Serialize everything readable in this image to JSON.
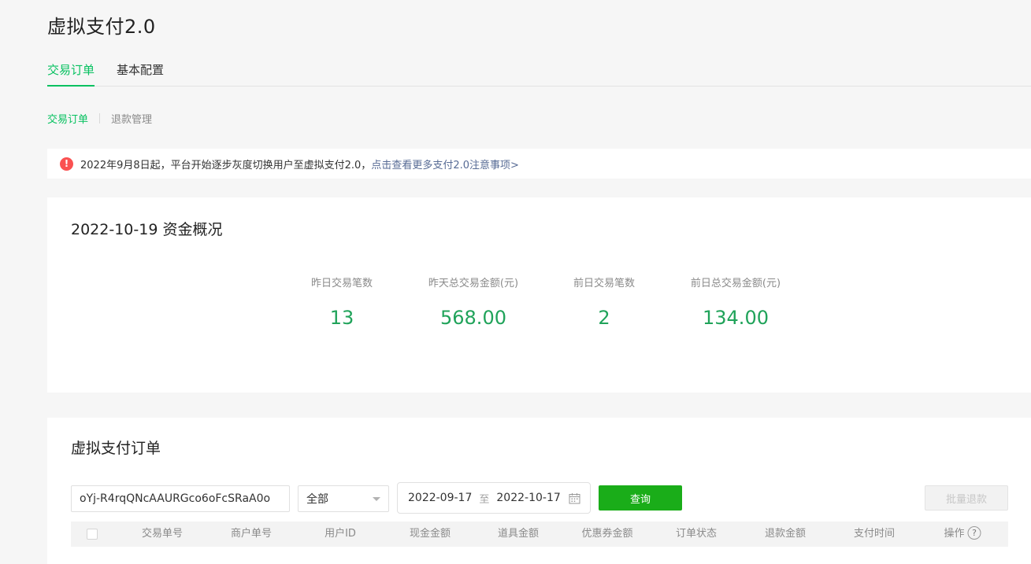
{
  "page": {
    "title": "虚拟支付2.0"
  },
  "main_tabs": [
    {
      "label": "交易订单",
      "active": true
    },
    {
      "label": "基本配置",
      "active": false
    }
  ],
  "sub_tabs": [
    {
      "label": "交易订单",
      "active": true
    },
    {
      "label": "退款管理",
      "active": false
    }
  ],
  "notice": {
    "icon": "exclamation-icon",
    "text": "2022年9月8日起，平台开始逐步灰度切换用户至虚拟支付2.0，",
    "link": "点击查看更多支付2.0注意事项>"
  },
  "summary": {
    "title": "2022-10-19 资金概况",
    "stats": [
      {
        "label": "昨日交易笔数",
        "value": "13"
      },
      {
        "label": "昨天总交易金额(元)",
        "value": "568.00"
      },
      {
        "label": "前日交易笔数",
        "value": "2"
      },
      {
        "label": "前日总交易金额(元)",
        "value": "134.00"
      }
    ]
  },
  "orders": {
    "title": "虚拟支付订单",
    "search_value": "oYj-R4rqQNcAAURGco6oFcSRaA0o",
    "status_select": "全部",
    "date_start": "2022-09-17",
    "date_separator": "至",
    "date_end": "2022-10-17",
    "query_label": "查询",
    "batch_refund_label": "批量退款",
    "columns": [
      "交易单号",
      "商户单号",
      "用户ID",
      "现金金额",
      "道具金额",
      "优惠券金额",
      "订单状态",
      "退款金额",
      "支付时间",
      "操作"
    ]
  },
  "colors": {
    "accent": "#07c160",
    "value_green": "#20a35a",
    "button_green": "#1aad19",
    "link": "#576b95",
    "error": "#fa5151"
  }
}
